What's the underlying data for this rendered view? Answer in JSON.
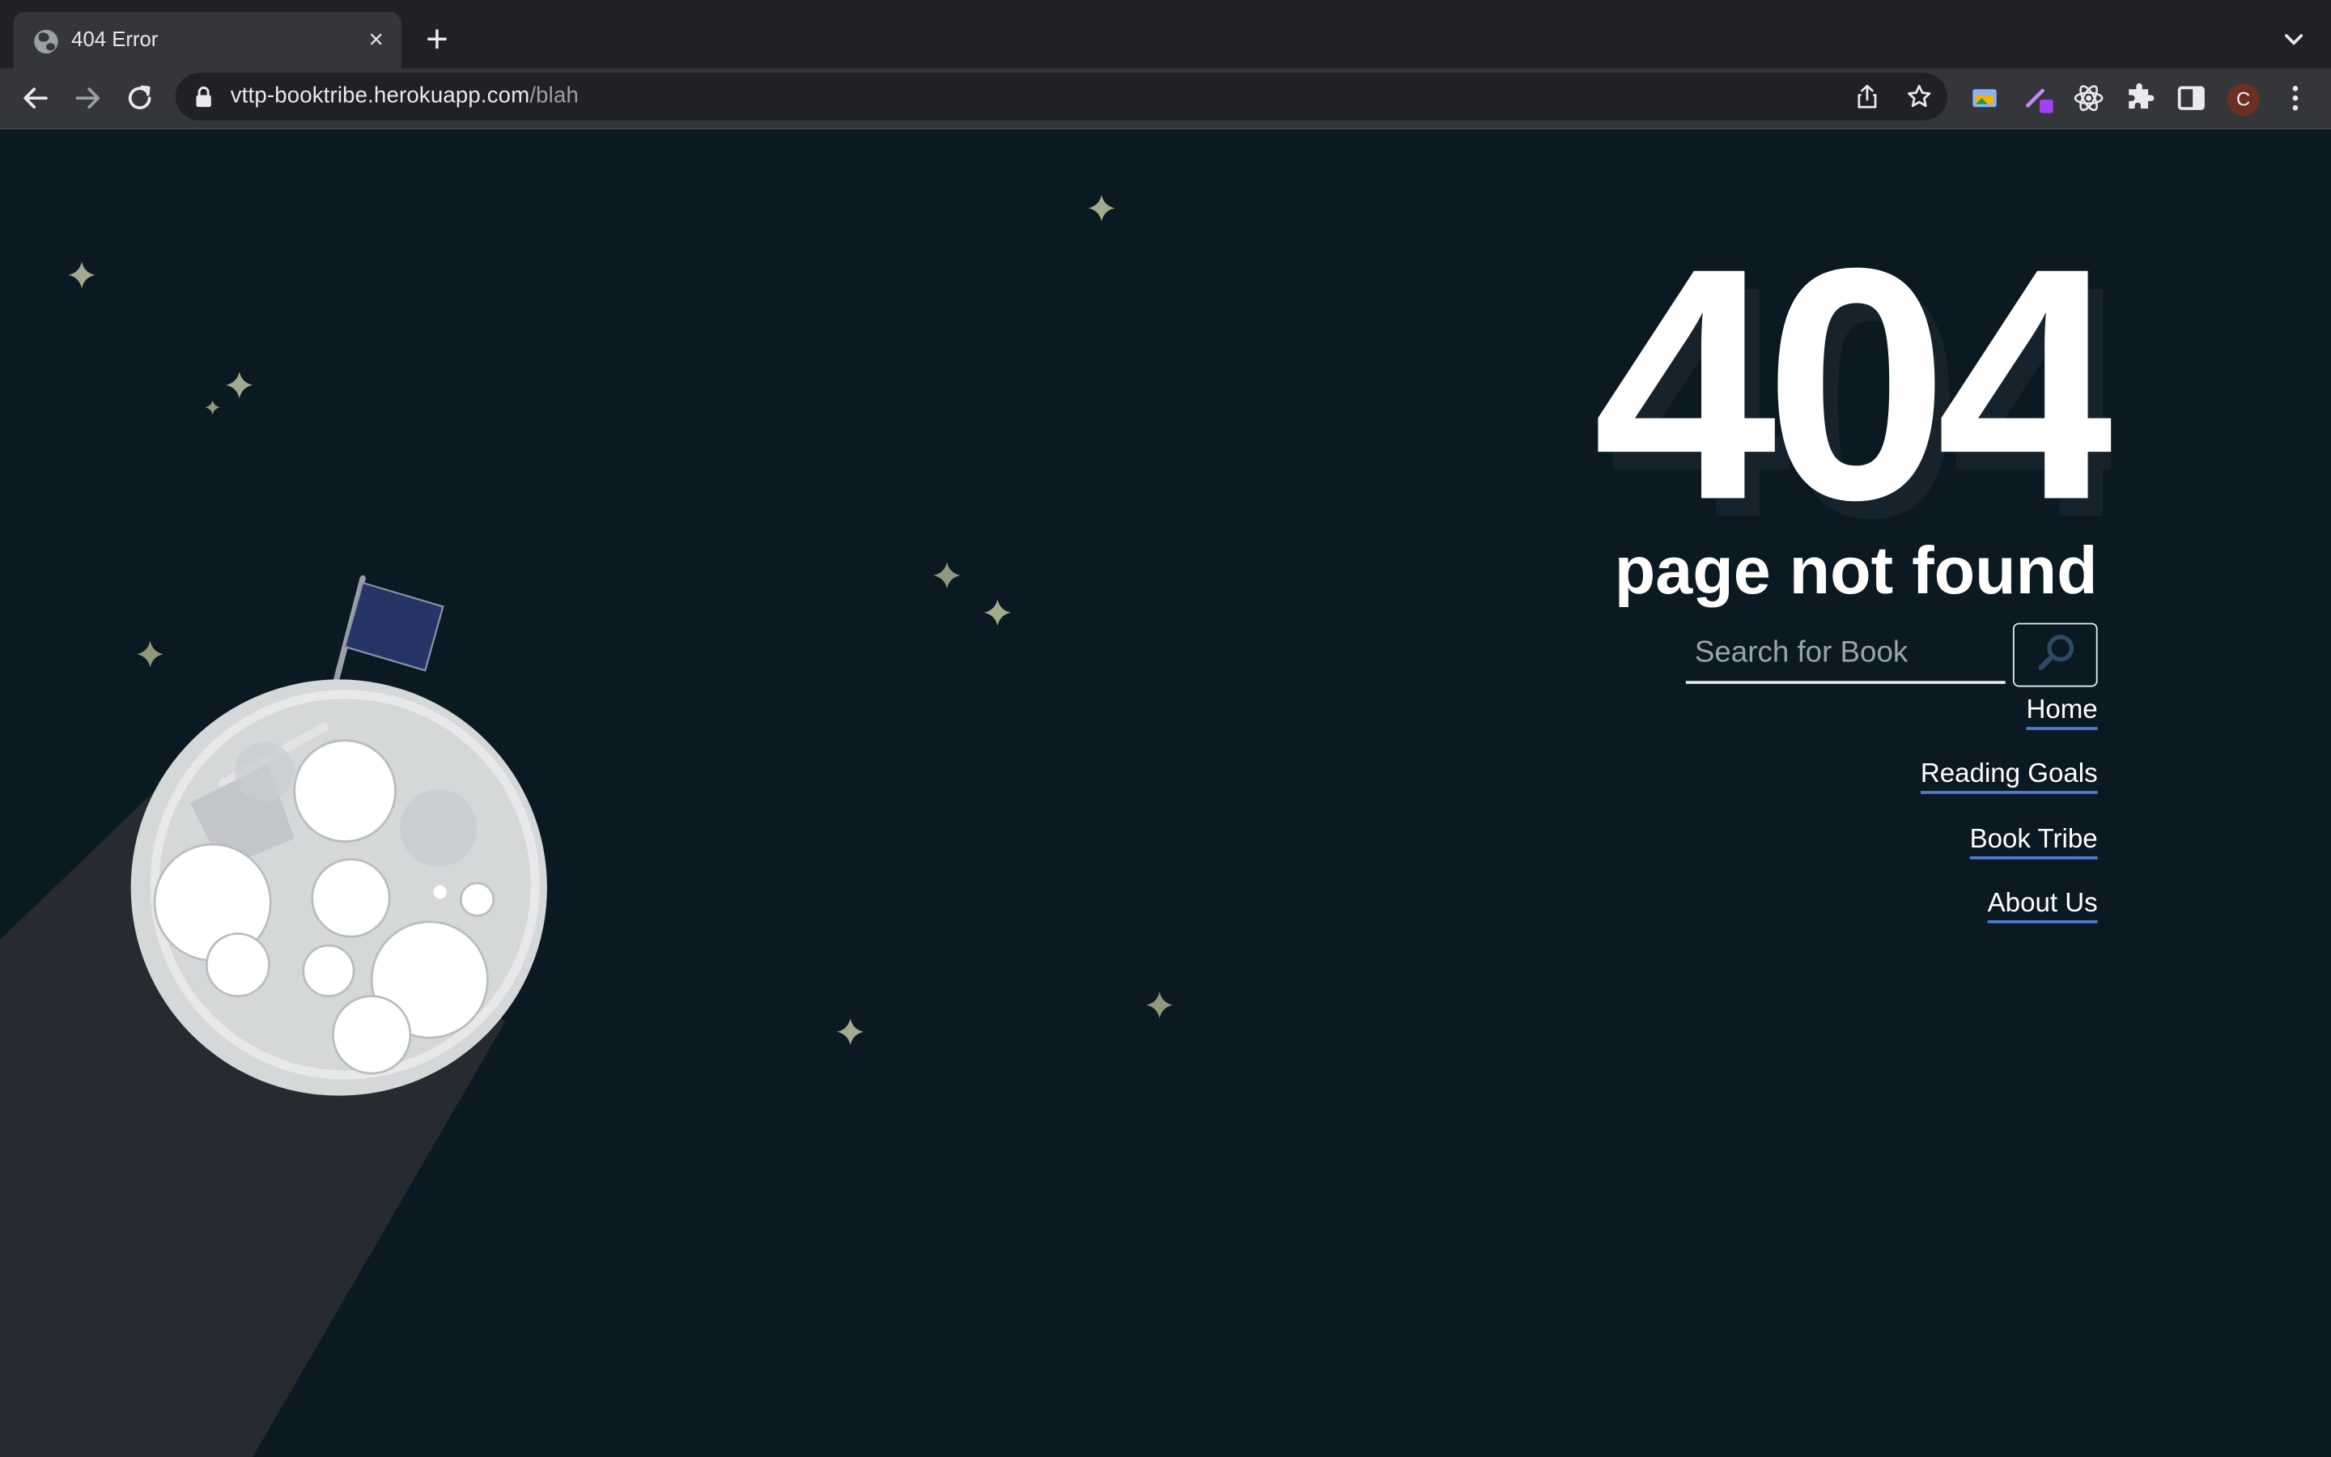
{
  "browser": {
    "tab": {
      "title": "404 Error",
      "favicon": "globe-icon",
      "close": "×"
    },
    "new_tab": "+",
    "url": {
      "domain": "vttp-booktribe.herokuapp.com",
      "path": "/blah"
    },
    "profile_initial": "C"
  },
  "page": {
    "error_code": "404",
    "headline": "page not found",
    "search": {
      "placeholder": "Search for Book",
      "value": ""
    },
    "nav": {
      "home": "Home",
      "reading_goals": "Reading Goals",
      "book_tribe": "Book Tribe",
      "about_us": "About Us"
    }
  },
  "colors": {
    "background": "#0b1922",
    "star": "#a3ab8c",
    "flag": "#263566",
    "moon": "#d5d8d9",
    "link_underline": "#4d7fd6"
  }
}
